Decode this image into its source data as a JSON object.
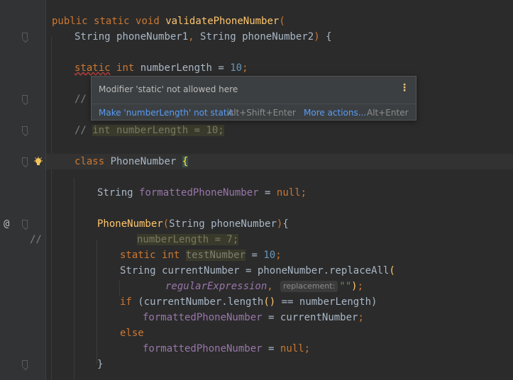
{
  "editor": {
    "lines": {
      "l1": {
        "kw1": "public",
        "kw2": "static",
        "kw3": "void",
        "name": "validatePhoneNumber",
        "open": "("
      },
      "l2": {
        "type1": "String",
        "p1": "phoneNumber1",
        "comma": ",",
        "type2": "String",
        "p2": "phoneNumber2",
        "close": ")",
        "brace": "{"
      },
      "l3": {
        "kw_static": "static",
        "kw_int": "int",
        "name": "numberLength",
        "eq": "=",
        "num": "10",
        "semi": ";"
      },
      "l4": {
        "comment": "//"
      },
      "l5": {
        "comment": "//",
        "dimmed": "int numberLength = 10;"
      },
      "l6": {
        "kw": "class",
        "name": "PhoneNumber",
        "brace": "{"
      },
      "l7": {
        "type": "String",
        "field": "formattedPhoneNumber",
        "eq": "=",
        "null": "null",
        "semi": ";"
      },
      "l8": {
        "name": "PhoneNumber",
        "open": "(",
        "type": "String",
        "param": "phoneNumber",
        "close": ")",
        "brace": "{"
      },
      "l9": {
        "gutter_comment": "//",
        "dimmed": "numberLength = 7;"
      },
      "l10": {
        "kw_static": "static",
        "kw_int": "int",
        "name": "testNumber",
        "eq": "=",
        "num": "10",
        "semi": ";"
      },
      "l11": {
        "type": "String",
        "var": "currentNumber",
        "eq": "=",
        "call": "phoneNumber.replaceAll",
        "open": "("
      },
      "l12": {
        "param": "regularExpression",
        "comma": ",",
        "hint": "replacement:",
        "str": "\"\"",
        "close": ")",
        "semi": ";"
      },
      "l13": {
        "kw": "if",
        "expr_start": "(currentNumber.length",
        "parens": "()",
        "expr_end": "== numberLength)"
      },
      "l14": {
        "field": "formattedPhoneNumber",
        "eq": "=",
        "var": "currentNumber",
        "semi": ";"
      },
      "l15": {
        "kw": "else"
      },
      "l16": {
        "field": "formattedPhoneNumber",
        "eq": "=",
        "null": "null",
        "semi": ";"
      },
      "l17": {
        "brace": "}"
      }
    },
    "gutter_at": "@"
  },
  "popup": {
    "message": "Modifier 'static' not allowed here",
    "more_icon": "⋮",
    "action1_label": "Make 'numberLength' not static",
    "action1_shortcut": "Alt+Shift+Enter",
    "action2_label": "More actions...",
    "action2_shortcut": "Alt+Enter"
  },
  "colors": {
    "background": "#2b2b2b",
    "keyword": "#cc7832",
    "function": "#ffc66d",
    "field": "#9876aa",
    "number": "#6897bb",
    "comment": "#808080",
    "link": "#589df6"
  }
}
